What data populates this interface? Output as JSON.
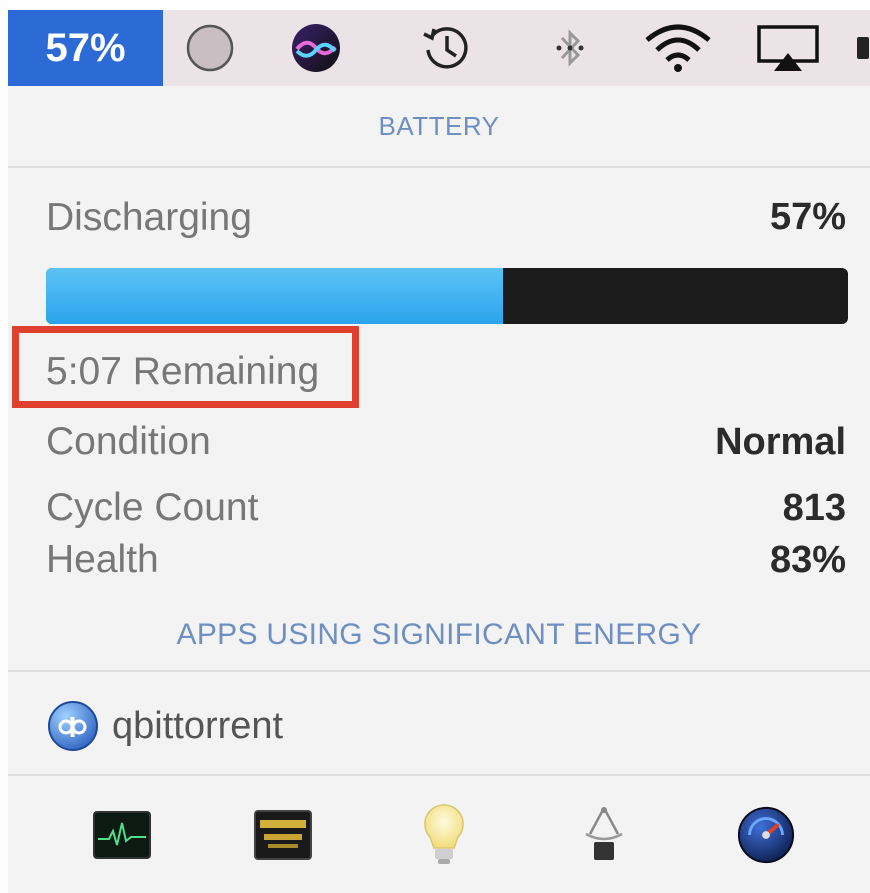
{
  "menubar": {
    "battery_percent": "57%",
    "icons": [
      "record-circle-icon",
      "siri-icon",
      "time-machine-icon",
      "bluetooth-icon",
      "wifi-icon",
      "airplay-icon"
    ],
    "accent": "#2c6bd6"
  },
  "battery": {
    "header": "BATTERY",
    "status_label": "Discharging",
    "status_value": "57%",
    "charge_level": 0.57,
    "remaining": "5:07 Remaining",
    "rows": [
      {
        "label": "Condition",
        "value": "Normal"
      },
      {
        "label": "Cycle Count",
        "value": "813"
      },
      {
        "label": "Health",
        "value": "83%"
      }
    ]
  },
  "energy": {
    "header": "APPS USING SIGNIFICANT ENERGY",
    "apps": [
      {
        "name": "qbittorrent",
        "icon": "qbittorrent-icon"
      }
    ]
  },
  "dock": {
    "icons": [
      "activity-monitor-icon",
      "console-icon",
      "light-bulb-icon",
      "system-information-icon",
      "disk-utility-icon"
    ]
  },
  "colors": {
    "highlight": "#e0402e",
    "progress_fill": "#2aa4eb",
    "header_text": "#6f8fc2"
  }
}
